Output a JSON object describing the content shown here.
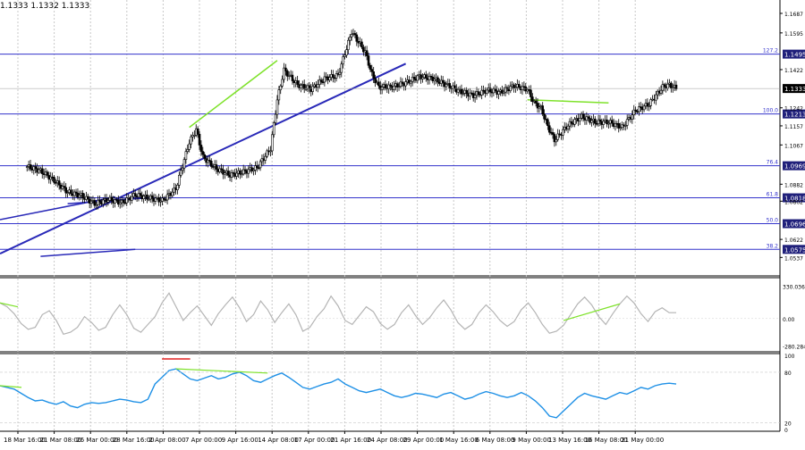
{
  "header": {
    "ohlc_text": "1.1333 1.1332 1.1333"
  },
  "colors": {
    "background": "#ffffff",
    "grid": "#c8c8c8",
    "fib_line": "#3333cc",
    "trend_line": "#2929b8",
    "divergence": "#7ee22a",
    "candles": "#000000",
    "cci": "#b4b4b4",
    "rsi": "#1e90e6",
    "rsi_marker": "#e02020",
    "price_label_bg": "#1f1f7a",
    "current_price_bg": "#000000"
  },
  "chart_data": {
    "type": "candlestick",
    "instrument": "EUR/USD",
    "timeframe": "4H",
    "x_tick_labels": [
      "18 Mar 16:00",
      "21 Mar 08:00",
      "26 Mar 00:00",
      "28 Mar 16:00",
      "2 Apr 08:00",
      "7 Apr 00:00",
      "9 Apr 16:00",
      "14 Apr 08:00",
      "17 Apr 00:00",
      "21 Apr 16:00",
      "24 Apr 08:00",
      "29 Apr 00:00",
      "1 May 16:00",
      "6 May 08:00",
      "9 May 00:00",
      "13 May 16:00",
      "16 May 08:00",
      "21 May 00:00"
    ],
    "price_axis": {
      "ylim": [
        1.045,
        1.175
      ],
      "ticks": [
        "1.1687",
        "1.1595",
        "1.1422",
        "1.1242",
        "1.1157",
        "1.1067",
        "1.0882",
        "1.0802",
        "1.0622",
        "1.0537"
      ]
    },
    "current_price": 1.1333,
    "current_price_label": "1.1333",
    "fib_levels": [
      {
        "pct_label": "127.2",
        "price": 1.1495,
        "label": "1.1495"
      },
      {
        "pct_label": "100.0",
        "price": 1.1213,
        "label": "1.1213"
      },
      {
        "pct_label": "76.4",
        "price": 1.0969,
        "label": "1.0969"
      },
      {
        "pct_label": "61.8",
        "price": 1.0818,
        "label": "1.0818"
      },
      {
        "pct_label": "50.0",
        "price": 1.0696,
        "label": "1.0696"
      },
      {
        "pct_label": "38.2",
        "price": 1.0575,
        "label": "1.0575"
      }
    ],
    "close_path": [
      [
        0,
        1.0965
      ],
      [
        2,
        1.0945
      ],
      [
        4,
        1.09
      ],
      [
        6,
        1.0845
      ],
      [
        8,
        1.0828
      ],
      [
        10,
        1.079
      ],
      [
        12,
        1.081
      ],
      [
        14,
        1.0795
      ],
      [
        16,
        1.0832
      ],
      [
        18,
        1.0818
      ],
      [
        20,
        1.0805
      ],
      [
        22,
        1.086
      ],
      [
        24,
        1.108
      ],
      [
        25,
        1.114
      ],
      [
        26,
        1.101
      ],
      [
        28,
        1.0955
      ],
      [
        30,
        1.0925
      ],
      [
        32,
        1.094
      ],
      [
        34,
        1.096
      ],
      [
        36,
        1.105
      ],
      [
        37,
        1.128
      ],
      [
        38,
        1.142
      ],
      [
        40,
        1.135
      ],
      [
        42,
        1.133
      ],
      [
        44,
        1.138
      ],
      [
        46,
        1.1395
      ],
      [
        48,
        1.16
      ],
      [
        50,
        1.1505
      ],
      [
        51,
        1.14
      ],
      [
        52,
        1.134
      ],
      [
        54,
        1.134
      ],
      [
        56,
        1.136
      ],
      [
        58,
        1.139
      ],
      [
        60,
        1.138
      ],
      [
        62,
        1.135
      ],
      [
        64,
        1.132
      ],
      [
        66,
        1.13
      ],
      [
        68,
        1.1325
      ],
      [
        70,
        1.1315
      ],
      [
        72,
        1.1345
      ],
      [
        74,
        1.133
      ],
      [
        75,
        1.1265
      ],
      [
        76,
        1.124
      ],
      [
        77,
        1.1155
      ],
      [
        78,
        1.109
      ],
      [
        80,
        1.116
      ],
      [
        82,
        1.12
      ],
      [
        84,
        1.1175
      ],
      [
        86,
        1.1175
      ],
      [
        88,
        1.115
      ],
      [
        90,
        1.123
      ],
      [
        92,
        1.126
      ],
      [
        94,
        1.134
      ],
      [
        95,
        1.135
      ],
      [
        96,
        1.1333
      ]
    ],
    "cci": {
      "ylim": [
        -340,
        400
      ],
      "ticks": [
        "330.0361",
        "0.00",
        "-280.2846"
      ],
      "values": [
        160,
        120,
        50,
        -50,
        -110,
        -90,
        40,
        80,
        -20,
        -160,
        -140,
        -90,
        20,
        -40,
        -120,
        -90,
        40,
        140,
        40,
        -100,
        -140,
        -60,
        20,
        160,
        260,
        120,
        -20,
        60,
        130,
        30,
        -70,
        50,
        140,
        220,
        110,
        -30,
        40,
        180,
        90,
        -40,
        60,
        150,
        40,
        -130,
        -90,
        20,
        100,
        230,
        130,
        -20,
        -60,
        30,
        120,
        70,
        -50,
        -110,
        -60,
        60,
        140,
        30,
        -60,
        10,
        110,
        190,
        90,
        -40,
        -110,
        -60,
        60,
        140,
        70,
        -20,
        -80,
        -30,
        90,
        160,
        60,
        -60,
        -150,
        -130,
        -70,
        40,
        150,
        220,
        140,
        20,
        -60,
        50,
        150,
        230,
        160,
        50,
        -30,
        70,
        110,
        60,
        60
      ]
    },
    "rsi": {
      "ylim": [
        10,
        100
      ],
      "ticks": [
        "100",
        "80",
        "20",
        "0"
      ],
      "values": [
        64,
        62,
        60,
        55,
        50,
        46,
        47,
        44,
        42,
        45,
        40,
        38,
        42,
        44,
        43,
        44,
        46,
        48,
        47,
        45,
        44,
        48,
        66,
        74,
        82,
        84,
        78,
        72,
        70,
        73,
        76,
        72,
        74,
        78,
        80,
        76,
        70,
        68,
        72,
        76,
        79,
        74,
        68,
        62,
        60,
        63,
        66,
        68,
        72,
        66,
        62,
        58,
        56,
        58,
        60,
        56,
        52,
        50,
        52,
        55,
        54,
        52,
        50,
        54,
        56,
        52,
        48,
        50,
        54,
        57,
        55,
        52,
        50,
        52,
        56,
        52,
        46,
        38,
        28,
        26,
        34,
        42,
        50,
        55,
        52,
        50,
        48,
        52,
        56,
        54,
        58,
        62,
        60,
        64,
        66,
        67,
        66
      ]
    }
  }
}
